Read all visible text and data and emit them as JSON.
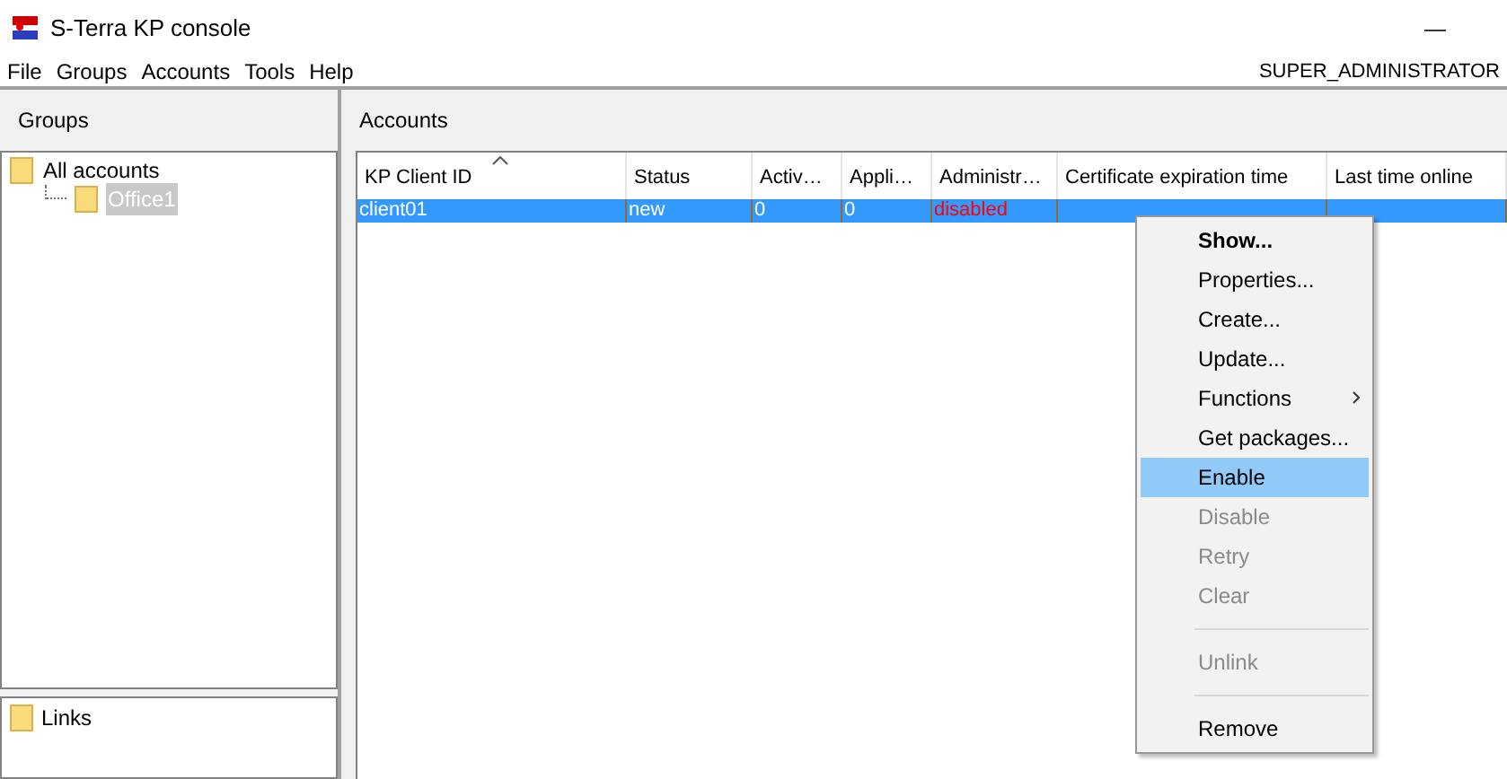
{
  "window": {
    "title": "S-Terra KP console",
    "minimize": "—"
  },
  "menu_bar": {
    "items": [
      "File",
      "Groups",
      "Accounts",
      "Tools",
      "Help"
    ],
    "user": "SUPER_ADMINISTRATOR"
  },
  "groups_panel": {
    "title": "Groups",
    "tree": [
      {
        "label": "All accounts",
        "selected": false,
        "children": [
          {
            "label": "Office1",
            "selected": true
          }
        ]
      }
    ],
    "links": [
      {
        "label": "Links"
      }
    ]
  },
  "accounts_panel": {
    "title": "Accounts",
    "table": {
      "columns": [
        {
          "label": "KP Client ID",
          "sorted": true
        },
        {
          "label": "Status",
          "sorted": false
        },
        {
          "label": "Activ…",
          "sorted": false
        },
        {
          "label": "Appli…",
          "sorted": false
        },
        {
          "label": "Administr…",
          "sorted": false
        },
        {
          "label": "Certificate expiration time",
          "sorted": false
        },
        {
          "label": "Last time online",
          "sorted": false
        }
      ],
      "rows": [
        {
          "selected": true,
          "cells": [
            {
              "text": "client01",
              "kind": "normal"
            },
            {
              "text": "new",
              "kind": "normal"
            },
            {
              "text": "0",
              "kind": "normal"
            },
            {
              "text": "0",
              "kind": "normal"
            },
            {
              "text": "disabled",
              "kind": "alert"
            },
            {
              "kind": "blank"
            },
            {
              "kind": "blank"
            }
          ]
        }
      ]
    }
  },
  "context_menu": {
    "items": [
      {
        "kind": "item",
        "label": "Show...",
        "default": true,
        "disabled": false,
        "selected": false,
        "submenu": false
      },
      {
        "kind": "item",
        "label": "Properties...",
        "default": false,
        "disabled": false,
        "selected": false,
        "submenu": false
      },
      {
        "kind": "item",
        "label": "Create...",
        "default": false,
        "disabled": false,
        "selected": false,
        "submenu": false
      },
      {
        "kind": "item",
        "label": "Update...",
        "default": false,
        "disabled": false,
        "selected": false,
        "submenu": false
      },
      {
        "kind": "item",
        "label": "Functions",
        "default": false,
        "disabled": false,
        "selected": false,
        "submenu": true
      },
      {
        "kind": "item",
        "label": "Get packages...",
        "default": false,
        "disabled": false,
        "selected": false,
        "submenu": false
      },
      {
        "kind": "item",
        "label": "Enable",
        "default": false,
        "disabled": false,
        "selected": true,
        "submenu": false
      },
      {
        "kind": "item",
        "label": "Disable",
        "default": false,
        "disabled": true,
        "selected": false,
        "submenu": false
      },
      {
        "kind": "item",
        "label": "Retry",
        "default": false,
        "disabled": true,
        "selected": false,
        "submenu": false
      },
      {
        "kind": "item",
        "label": "Clear",
        "default": false,
        "disabled": true,
        "selected": false,
        "submenu": false
      },
      {
        "kind": "separator"
      },
      {
        "kind": "item",
        "label": "Unlink",
        "default": false,
        "disabled": true,
        "selected": false,
        "submenu": false
      },
      {
        "kind": "separator"
      },
      {
        "kind": "item",
        "label": "Remove",
        "default": false,
        "disabled": false,
        "selected": false,
        "submenu": false
      }
    ]
  }
}
